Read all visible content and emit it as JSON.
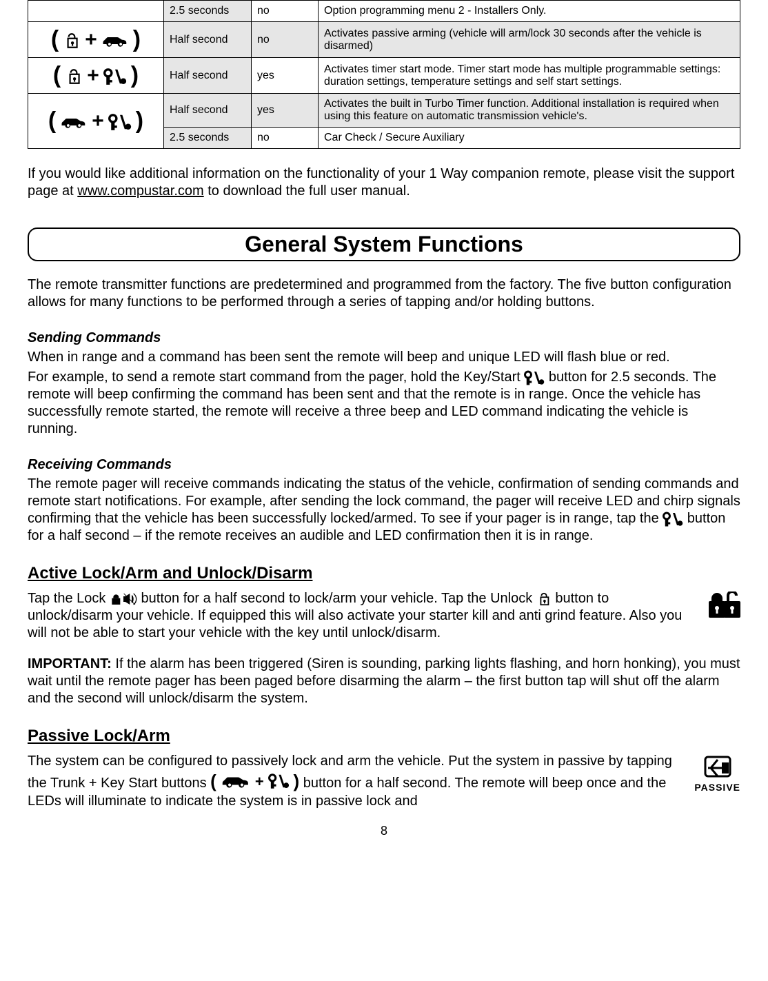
{
  "table": {
    "rows": [
      {
        "press": "2.5 seconds",
        "yn": "no",
        "desc": "Option programming menu 2 - Installers Only."
      },
      {
        "press": "Half second",
        "yn": "no",
        "desc": "Activates passive arming (vehicle will arm/lock 30 seconds after the vehicle is disarmed)"
      },
      {
        "press": "Half second",
        "yn": "yes",
        "desc": "Activates timer start mode. Timer start mode has multiple programmable settings: duration settings, temperature settings and self start settings."
      },
      {
        "press": "Half second",
        "yn": "yes",
        "desc": "Activates the built in Turbo Timer function. Additional installation is required when using this feature on automatic transmission vehicle's."
      },
      {
        "press": "2.5 seconds",
        "yn": "no",
        "desc": "Car Check / Secure Auxiliary"
      }
    ]
  },
  "intro_text_1": "If you would like additional information on the functionality of your 1 Way companion remote, please visit the support page at ",
  "intro_link": "www.compustar.com",
  "intro_text_2": " to download the full user manual.",
  "section_title": "General System Functions",
  "gsf_intro": "The remote transmitter functions are predetermined and programmed from the factory. The five button configuration allows for many functions to be performed through a series of tapping and/or holding buttons.",
  "sending_heading": "Sending Commands",
  "sending_line1": "When in range and a command has been sent the remote will beep and unique LED will flash blue or red.",
  "sending_p2a": "For example, to send a remote start command from the pager, hold the Key/Start ",
  "sending_p2b": " button for 2.5 seconds. The remote will beep confirming the command has been sent and that the remote is in range. Once the vehicle has successfully remote started, the remote will receive a three beep and LED command indicating the vehicle is running.",
  "receiving_heading": "Receiving Commands",
  "receiving_p1a": "The remote pager will receive commands indicating the status of the vehicle, confirmation of sending commands and remote start notifications. For example, after sending the lock command, the pager will receive LED and chirp signals confirming that the vehicle has been successfully locked/armed. To see if your pager is in range, tap the ",
  "receiving_p1b": " button for a half second – if the remote receives an audible and LED confirmation then it is in range.",
  "active_heading": "Active Lock/Arm and Unlock/Disarm",
  "active_p_a": "Tap the Lock ",
  "active_p_b": " button for a half second to lock/arm your vehicle. Tap the Unlock ",
  "active_p_c": " button to unlock/disarm your vehicle. If equipped this will also activate your starter kill and anti grind feature. Also you will not be able to start your vehicle with the key until unlock/disarm.",
  "important_label": "IMPORTANT:",
  "important_text": "  If the alarm has been triggered (Siren is sounding, parking lights flashing, and horn honking), you must wait until the remote pager has been paged before disarming the alarm – the first button tap will shut off the alarm and the second will unlock/disarm the system.",
  "passive_heading": "Passive Lock/Arm",
  "passive_p_a": "The system can be configured to passively lock and arm the vehicle. Put the system in passive by tapping the Trunk + Key Start buttons ",
  "passive_p_b": " button for a half second. The remote will beep once and the LEDs will illuminate to indicate the system is in passive lock and",
  "passive_badge": "PASSIVE",
  "page_number": "8"
}
